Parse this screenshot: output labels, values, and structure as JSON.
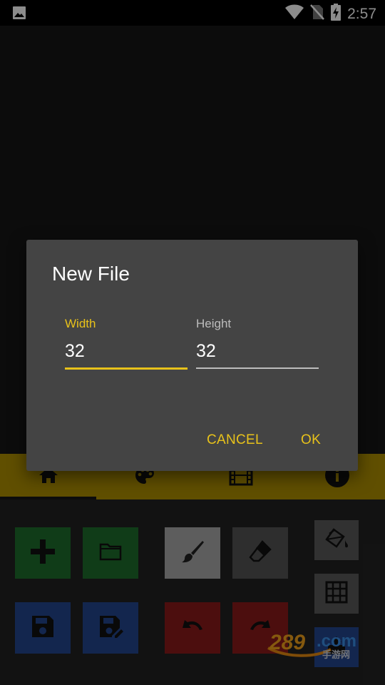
{
  "status_bar": {
    "time": "2:57",
    "icons": [
      "gallery-icon",
      "wifi-icon",
      "no-sim-icon",
      "battery-charging-icon"
    ]
  },
  "tabs": [
    {
      "icon": "home-icon"
    },
    {
      "icon": "palette-icon"
    },
    {
      "icon": "film-icon"
    },
    {
      "icon": "info-icon"
    }
  ],
  "tools": [
    "add",
    "open-folder",
    "brush",
    "eraser",
    "fill",
    "save",
    "save-as",
    "undo",
    "redo",
    "grid",
    "export"
  ],
  "dialog": {
    "title": "New File",
    "width_label": "Width",
    "width_value": "32",
    "height_label": "Height",
    "height_value": "32",
    "cancel_label": "CANCEL",
    "ok_label": "OK"
  },
  "colors": {
    "accent": "#e8c21a",
    "tab_bar": "#b09000",
    "dialog_bg": "#444444",
    "green_tool": "#1e6e2c",
    "blue_tool": "#23458f",
    "red_tool": "#8a1a1a"
  }
}
